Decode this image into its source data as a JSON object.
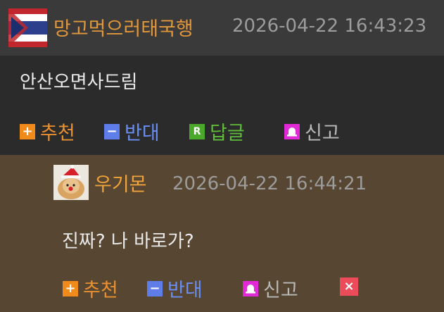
{
  "post": {
    "username": "망고먹으러태국행",
    "timestamp": "2026-04-22 16:43:23",
    "content": "안산오면사드림",
    "actions": {
      "recommend": "추천",
      "oppose": "반대",
      "reply": "답글",
      "report": "신고"
    }
  },
  "reply": {
    "username": "우기몬",
    "timestamp": "2026-04-22 16:44:21",
    "content": "진짜? 나 바로가?",
    "actions": {
      "recommend": "추천",
      "oppose": "반대",
      "report": "신고"
    }
  },
  "icons": {
    "plus": "+",
    "minus": "−",
    "reply_badge": "R",
    "delete": "×"
  },
  "colors": {
    "username": "#e2983a",
    "recommend": "#e99031",
    "oppose": "#6a8ff2",
    "reply": "#5fbd39",
    "report": "#b9b9b9",
    "delete": "#ec4b5a"
  }
}
